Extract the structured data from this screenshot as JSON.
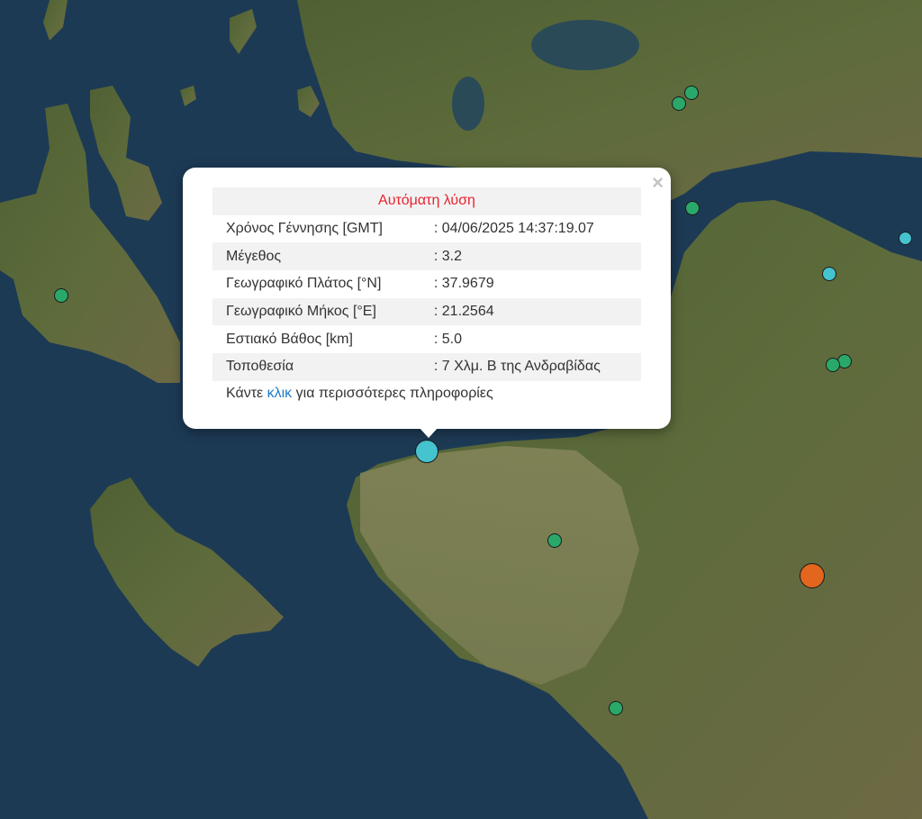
{
  "popup": {
    "title": "Αυτόματη λύση",
    "close_label": "×",
    "rows": [
      {
        "label": "Χρόνος Γέννησης [GMT]",
        "value": ": 04/06/2025 14:37:19.07"
      },
      {
        "label": "Μέγεθος",
        "value": ": 3.2"
      },
      {
        "label": "Γεωγραφικό Πλάτος [°N]",
        "value": ": 37.9679"
      },
      {
        "label": "Γεωγραφικό Μήκος [°E]",
        "value": ": 21.2564"
      },
      {
        "label": "Εστιακό Βάθος [km]",
        "value": ": 5.0"
      },
      {
        "label": "Τοποθεσία",
        "value": ": 7 Χλμ. Β της Ανδραβίδας"
      }
    ],
    "more_prefix": "Κάντε ",
    "more_link": "κλικ",
    "more_suffix": " για περισσότερες πληροφορίες"
  },
  "colors": {
    "sea": "#1d3a55",
    "land": "#56663a",
    "marker_green": "#2aa86a",
    "marker_cyan": "#45c3cf",
    "marker_orange": "#e2661e",
    "title_red": "#e8232f",
    "link_blue": "#1f79c8"
  }
}
